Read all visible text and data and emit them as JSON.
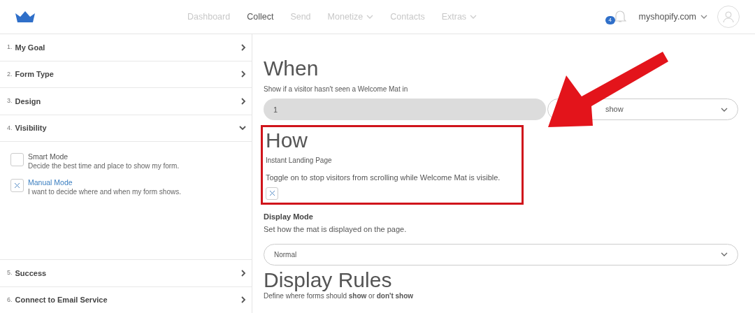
{
  "nav": {
    "items": [
      {
        "label": "Dashboard",
        "selected": false,
        "dropdown": false
      },
      {
        "label": "Collect",
        "selected": true,
        "dropdown": false
      },
      {
        "label": "Send",
        "selected": false,
        "dropdown": false
      },
      {
        "label": "Monetize",
        "selected": false,
        "dropdown": true
      },
      {
        "label": "Contacts",
        "selected": false,
        "dropdown": false
      },
      {
        "label": "Extras",
        "selected": false,
        "dropdown": true
      }
    ],
    "notification_count": "4",
    "account": "myshopify.com"
  },
  "sidebar": {
    "steps": [
      {
        "number": "1.",
        "label": "My Goal",
        "expanded": false
      },
      {
        "number": "2.",
        "label": "Form Type",
        "expanded": false
      },
      {
        "number": "3.",
        "label": "Design",
        "expanded": false
      },
      {
        "number": "4.",
        "label": "Visibility",
        "expanded": true,
        "options": [
          {
            "title": "Smart Mode",
            "description": "Decide the best time and place to show my form.",
            "checked": false
          },
          {
            "title": "Manual Mode",
            "description": "I want to decide where and when my form shows.",
            "checked": true
          }
        ]
      },
      {
        "number": "5.",
        "label": "Success",
        "expanded": false
      },
      {
        "number": "6.",
        "label": "Connect to Email Service",
        "expanded": false
      }
    ]
  },
  "main": {
    "when": {
      "heading": "When",
      "label": "Show if a visitor hasn't seen a Welcome Mat in",
      "value": "1",
      "unit": "show"
    },
    "how": {
      "heading": "How",
      "label": "Instant Landing Page",
      "description": "Toggle on to stop visitors from scrolling while Welcome Mat is visible.",
      "checked": true,
      "highlighted": true
    },
    "display_mode": {
      "label": "Display Mode",
      "description": "Set how the mat is displayed on the page.",
      "value": "Normal"
    },
    "display_rules": {
      "heading": "Display Rules",
      "description": "Define where forms should **show** or **don't show**"
    }
  }
}
